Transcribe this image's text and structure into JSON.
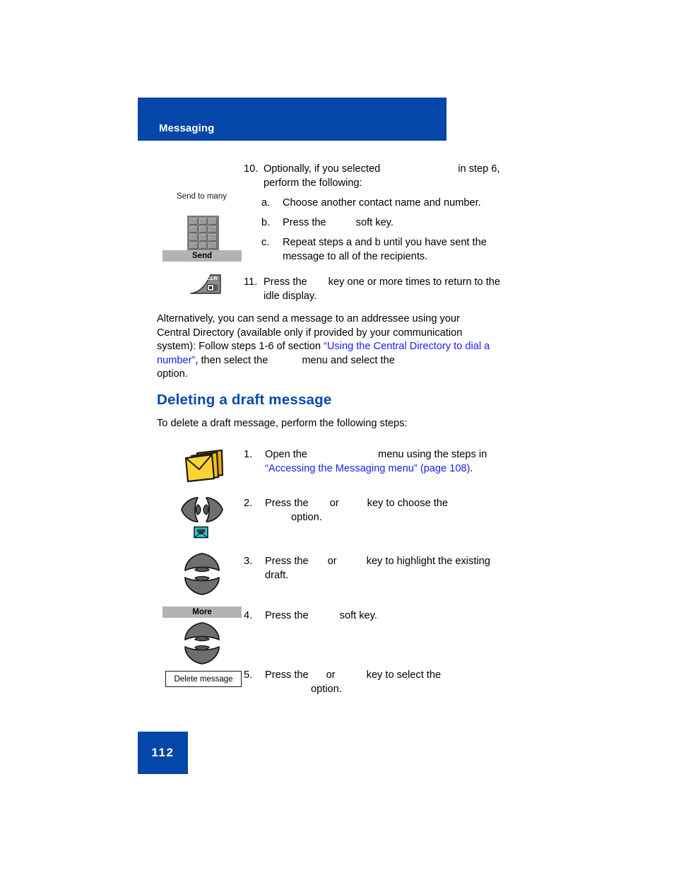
{
  "document": {
    "header_title": "Messaging",
    "page_number": "112",
    "accent_color": "#0447a8",
    "heading_color": "#0a47b0",
    "link_color": "#1a1afa"
  },
  "step10": {
    "number": "10.",
    "line1_before": "Optionally, if you selected",
    "line1_after": "in step 6,",
    "line2": "perform the following:"
  },
  "substeps": [
    {
      "marker": "a.",
      "text": "Choose another contact name and number."
    },
    {
      "marker": "b.",
      "before": "Press the",
      "after": "soft key."
    },
    {
      "marker": "c.",
      "line1": "Repeat steps a and b until you have sent the",
      "line2": "message to all of the recipients."
    }
  ],
  "step11": {
    "number": "11.",
    "before": "Press the",
    "after": "key one or more times to return to the",
    "line2": "idle display."
  },
  "alternatively": {
    "line1": "Alternatively, you can send a message to an addressee using your",
    "line2": "Central Directory (available only if provided by your communication",
    "line3_before": "system): Follow steps 1-6 of section ",
    "link_part1": "“Using the Central Directory to dial a",
    "link_part2": "number”",
    "line4_mid": ", then select the",
    "line4_after": "menu and select the",
    "line5": "option."
  },
  "section": {
    "heading": "Deleting a draft message",
    "intro": "To delete a draft message, perform the following steps:"
  },
  "delete_steps": [
    {
      "number": "1.",
      "line1_before": "Open the",
      "line1_after": "menu using the steps in",
      "link": "“Accessing the Messaging menu” (page 108)",
      "line2_tail": "."
    },
    {
      "number": "2.",
      "line1_before": "Press the",
      "line1_mid": "or",
      "line1_after": "key to choose the",
      "line2": "option."
    },
    {
      "number": "3.",
      "line1_before": "Press the",
      "line1_mid": "or",
      "line1_after": "key to highlight the existing",
      "line2": "draft."
    },
    {
      "number": "4.",
      "line1_before": "Press the",
      "line1_after": "soft key."
    },
    {
      "number": "5.",
      "line1_before": "Press the",
      "line1_mid": "or",
      "line1_after": "key to select the",
      "line2": "option."
    }
  ],
  "art": {
    "send_to_many_caption": "Send to many",
    "send_softkey_label": "Send",
    "clr_key_label": "CLR",
    "more_softkey_label": "More",
    "delete_message_box_label": "Delete message"
  }
}
